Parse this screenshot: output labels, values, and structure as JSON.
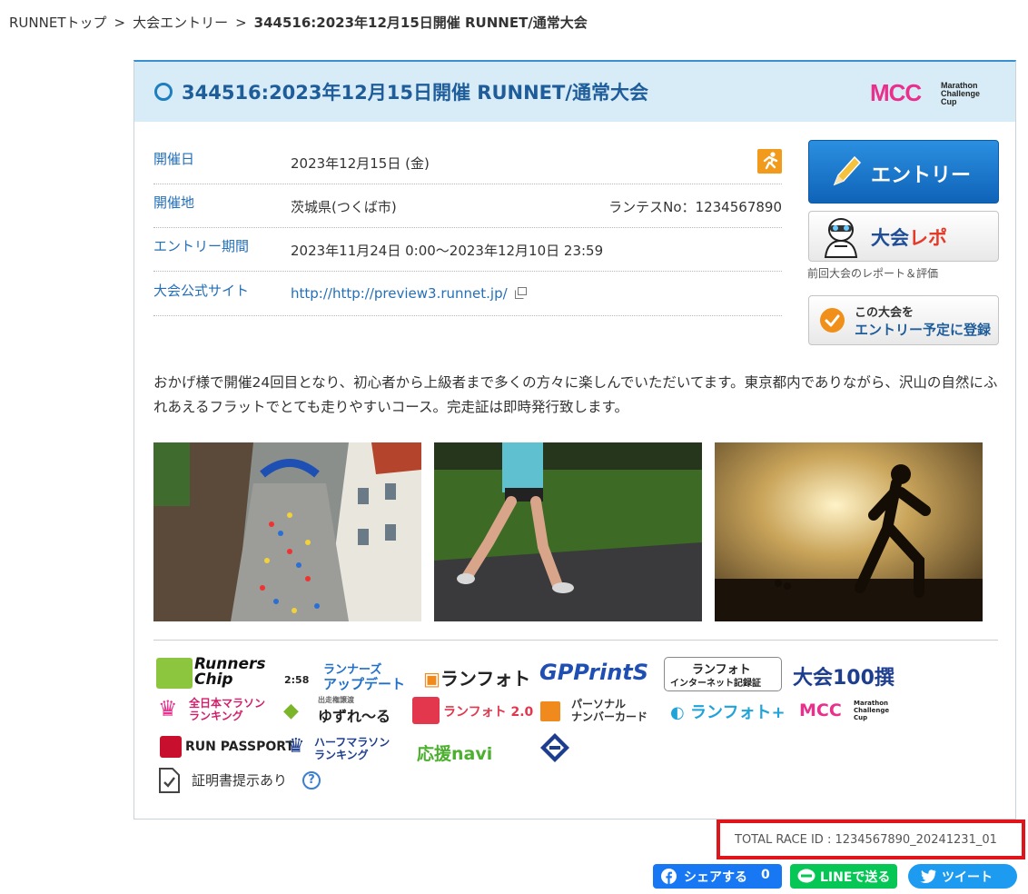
{
  "breadcrumb": {
    "items": [
      "RUNNETトップ",
      "大会エントリー"
    ],
    "separator": ">",
    "current": "344516:2023年12月15日開催 RUNNET/通常大会"
  },
  "race": {
    "title": "344516:2023年12月15日開催 RUNNET/通常大会",
    "header_logo": "MCC Marathon Challenge Cup"
  },
  "info": {
    "date_label": "開催日",
    "date_value": "2023年12月15日 (金)",
    "venue_label": "開催地",
    "venue_value": "茨城県(つくば市)",
    "runtest_no": "ランテスNo：1234567890",
    "entry_period_label": "エントリー期間",
    "entry_period_value": "2023年11月24日 0:00～2023年12月10日 23:59",
    "site_label": "大会公式サイト",
    "site_url": "http://http://preview3.runnet.jp/"
  },
  "actions": {
    "entry_label": "エントリー",
    "repo_label_main": "大会",
    "repo_label_accent": "レポ",
    "repo_caption": "前回大会のレポート＆評価",
    "plan_line1": "この大会を",
    "plan_line2": "エントリー予定に登録"
  },
  "description": "おかげ様で開催24回目となり、初心者から上級者まで多くの方々に楽しんでいただいてます。東京都内でありながら、沢山の自然にふれあえるフラットでとても走りやすいコース。完走証は即時発行致します。",
  "logos": {
    "runners_chip_1": "Runners",
    "runners_chip_2": "Chip",
    "update_1": "ランナーズ",
    "update_2": "アップデート",
    "update_time": "2:58",
    "runphoto": "ランフォト",
    "gp_prints": "GPPrintS",
    "runphoto_cert_1": "ランフォト",
    "runphoto_cert_2": "インターネット記録証",
    "taikai100": "大会100撰",
    "ranking_1": "全日本マラソン",
    "ranking_2": "ランキング",
    "yuzureru_small": "出走権譲渡",
    "yuzureru": "ゆずれ～る",
    "runphoto2": "ランフォト 2.0",
    "personal_1": "パーソナル",
    "personal_2": "ナンバーカード",
    "runphoto_plus": "ランフォト",
    "mcc_small": "Marathon Challenge Cup",
    "run_passport": "RUN PASSPORT",
    "half_1": "ハーフマラソン",
    "half_2": "ランキング",
    "ouen": "応援navi"
  },
  "certificate_text": "証明書提示あり",
  "help_icon_text": "?",
  "total_race_id": "TOTAL RACE ID : 1234567890_20241231_01",
  "share": {
    "facebook_label": "シェアする",
    "facebook_count": "0",
    "line_label": "LINEで送る",
    "tweet_label": "ツイート"
  },
  "colors": {
    "accent_blue": "#1f5d9a",
    "header_bg": "#d8ecf7",
    "entry_button": "#1a73c9",
    "highlight_red": "#e0141b",
    "facebook": "#1877f2",
    "line": "#06c755",
    "twitter": "#1d9bf0"
  }
}
